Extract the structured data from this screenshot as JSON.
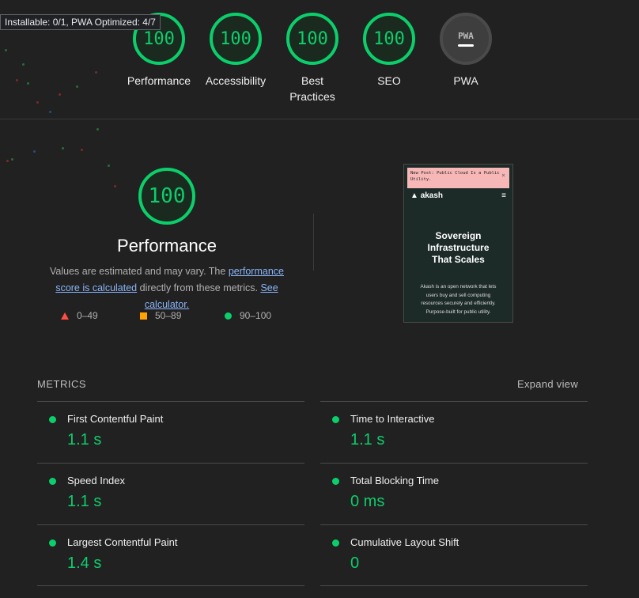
{
  "tooltip": "Installable: 0/1, PWA Optimized: 4/7",
  "gauges": [
    {
      "score": "100",
      "label": "Performance"
    },
    {
      "score": "100",
      "label": "Accessibility"
    },
    {
      "score": "100",
      "label": "Best Practices"
    },
    {
      "score": "100",
      "label": "SEO"
    }
  ],
  "pwa": {
    "badge": "PWA",
    "label": "PWA"
  },
  "performance": {
    "score": "100",
    "title": "Performance",
    "desc_prefix": "Values are estimated and may vary. The ",
    "link1": "performance score is calculated",
    "desc_mid": " directly from these metrics. ",
    "link2": "See calculator."
  },
  "legend": [
    {
      "range": "0–49",
      "color": "#ff4e42"
    },
    {
      "range": "50–89",
      "color": "#ffa400"
    },
    {
      "range": "90–100",
      "color": "#0cce6b"
    }
  ],
  "thumbnail": {
    "banner": "New Post: Public Cloud Is a Public Utility.",
    "close": "×",
    "brand": "akash",
    "menu": "≡",
    "headline": "Sovereign Infrastructure That Scales",
    "body": "Akash is an open network that lets users buy and sell computing resources securely and efficiently. Purpose-built for public utility."
  },
  "metrics": {
    "heading": "METRICS",
    "expand": "Expand view",
    "items": [
      {
        "label": "First Contentful Paint",
        "value": "1.1 s"
      },
      {
        "label": "Time to Interactive",
        "value": "1.1 s"
      },
      {
        "label": "Speed Index",
        "value": "1.1 s"
      },
      {
        "label": "Total Blocking Time",
        "value": "0 ms"
      },
      {
        "label": "Largest Contentful Paint",
        "value": "1.4 s"
      },
      {
        "label": "Cumulative Layout Shift",
        "value": "0"
      }
    ]
  },
  "colors": {
    "pass": "#0cce6b",
    "average": "#ffa400",
    "fail": "#ff4e42",
    "background": "#212121"
  }
}
